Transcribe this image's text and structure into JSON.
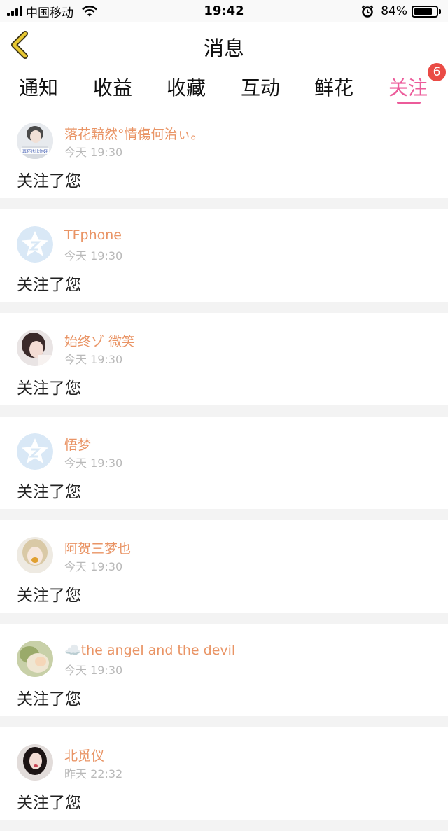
{
  "status_bar": {
    "carrier": "中国移动",
    "time": "19:42",
    "battery": "84%",
    "battery_level": 0.84,
    "icons": [
      "signal-icon",
      "wifi-icon",
      "alarm-icon",
      "battery-icon"
    ]
  },
  "nav": {
    "title": "消息",
    "back_icon": "chevron-left-icon"
  },
  "tabs": [
    {
      "label": "通知",
      "active": false
    },
    {
      "label": "收益",
      "active": false
    },
    {
      "label": "收藏",
      "active": false
    },
    {
      "label": "互动",
      "active": false
    },
    {
      "label": "鲜花",
      "active": false
    },
    {
      "label": "关注",
      "active": true,
      "badge": "6"
    }
  ],
  "colors": {
    "accent": "#ec5b9a",
    "username": "#e99465",
    "badge": "#ea4b45",
    "back_icon": "#e8c832"
  },
  "items": [
    {
      "username": "落花黯然°情傷何治ぃ。",
      "time": "今天 19:30",
      "message": "关注了您",
      "avatar": "photo-avatar",
      "avatar_text": "再坏也比你好"
    },
    {
      "username": "TFphone",
      "time": "今天 19:30",
      "message": "关注了您",
      "avatar": "default-avatar-icon"
    },
    {
      "username": "始终ゾ 微笑",
      "time": "今天 19:30",
      "message": "关注了您",
      "avatar": "photo-avatar"
    },
    {
      "username": "悟梦",
      "time": "今天 19:30",
      "message": "关注了您",
      "avatar": "default-avatar-icon"
    },
    {
      "username": "阿贺三梦也",
      "time": "今天 19:30",
      "message": "关注了您",
      "avatar": "photo-avatar"
    },
    {
      "username": "☁️the angel and the devil",
      "time": "今天 19:30",
      "message": "关注了您",
      "avatar": "photo-avatar"
    },
    {
      "username": "北觅仪",
      "time": "昨天 22:32",
      "message": "关注了您",
      "avatar": "photo-avatar"
    }
  ]
}
